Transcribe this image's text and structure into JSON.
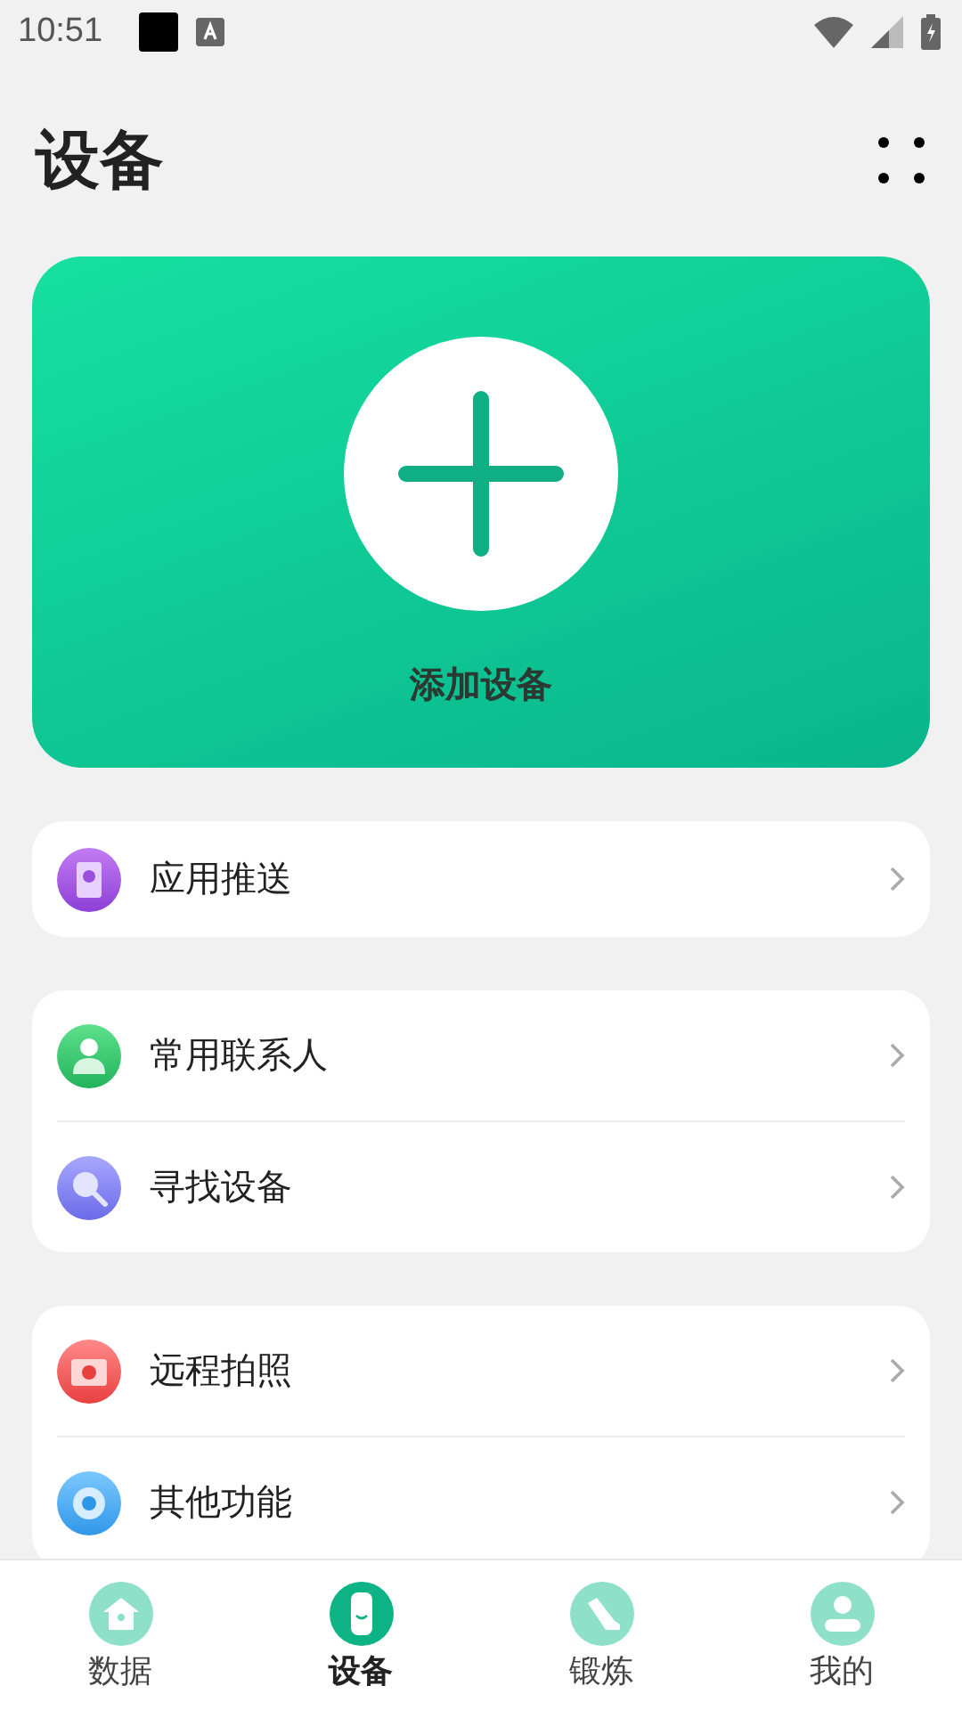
{
  "status_bar": {
    "time": "10:51"
  },
  "header": {
    "title": "设备"
  },
  "add_card": {
    "label": "添加设备"
  },
  "groups": [
    {
      "items": [
        {
          "kind": "phone",
          "label": "应用推送"
        }
      ]
    },
    {
      "items": [
        {
          "kind": "contact",
          "label": "常用联系人"
        },
        {
          "kind": "search",
          "label": "寻找设备"
        }
      ]
    },
    {
      "items": [
        {
          "kind": "camera",
          "label": "远程拍照"
        },
        {
          "kind": "gear",
          "label": "其他功能"
        }
      ]
    }
  ],
  "nav": [
    {
      "kind": "home",
      "label": "数据",
      "selected": false
    },
    {
      "kind": "watch",
      "label": "设备",
      "selected": true
    },
    {
      "kind": "shoe",
      "label": "锻炼",
      "selected": false
    },
    {
      "kind": "person",
      "label": "我的",
      "selected": false
    }
  ]
}
